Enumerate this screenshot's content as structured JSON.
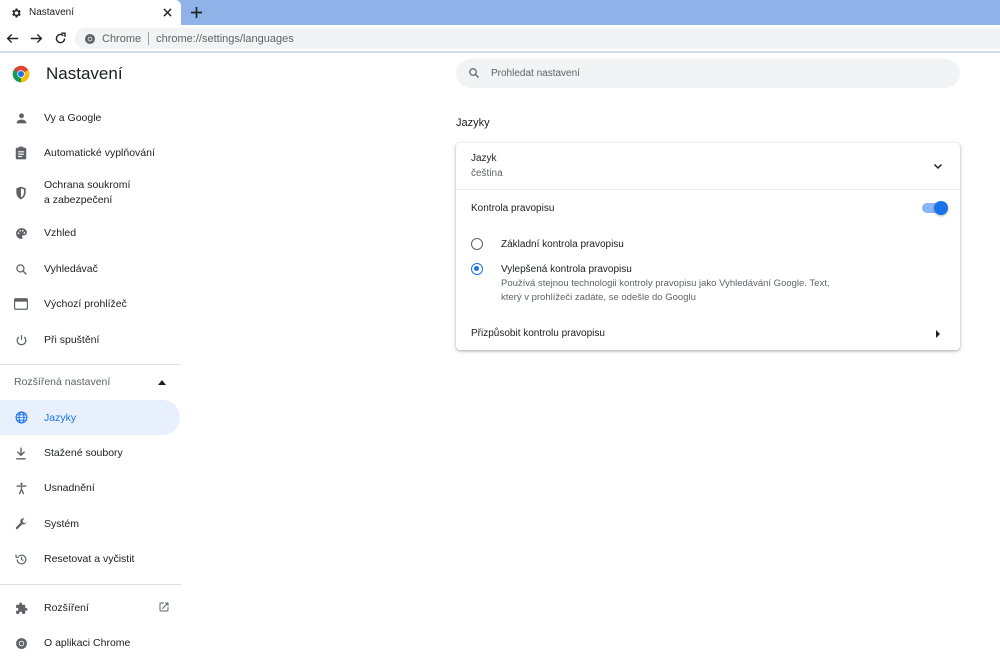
{
  "tab": {
    "title": "Nastavení",
    "icon": "gear-icon"
  },
  "omnibox": {
    "chip": "Chrome",
    "url": "chrome://settings/languages"
  },
  "app": {
    "title": "Nastavení"
  },
  "search": {
    "placeholder": "Prohledat nastavení"
  },
  "sidebar": {
    "items": [
      {
        "label": "Vy a Google",
        "icon": "person-icon"
      },
      {
        "label": "Automatické vyplňování",
        "icon": "clipboard-icon"
      },
      {
        "label_line1": "Ochrana soukromí",
        "label_line2": "a zabezpečení",
        "icon": "shield-icon"
      },
      {
        "label": "Vzhled",
        "icon": "palette-icon"
      },
      {
        "label": "Vyhledávač",
        "icon": "search-icon"
      },
      {
        "label": "Výchozí prohlížeč",
        "icon": "browser-icon"
      },
      {
        "label": "Při spuštění",
        "icon": "power-icon"
      }
    ],
    "advanced": {
      "label": "Rozšířená nastavení"
    },
    "advanced_items": [
      {
        "label": "Jazyky",
        "icon": "globe-icon"
      },
      {
        "label": "Stažené soubory",
        "icon": "download-icon"
      },
      {
        "label": "Usnadnění",
        "icon": "accessibility-icon"
      },
      {
        "label": "Systém",
        "icon": "wrench-icon"
      },
      {
        "label": "Resetovat a vyčistit",
        "icon": "restore-icon"
      }
    ],
    "extensions": {
      "label": "Rozšíření",
      "icon": "puzzle-icon"
    },
    "about": {
      "label": "O aplikaci Chrome",
      "icon": "chrome-icon"
    }
  },
  "main": {
    "section_title": "Jazyky",
    "language": {
      "label": "Jazyk",
      "value": "čeština"
    },
    "spellcheck": {
      "label": "Kontrola pravopisu",
      "enabled": true,
      "options": [
        {
          "label": "Základní kontrola pravopisu",
          "checked": false
        },
        {
          "label": "Vylepšená kontrola pravopisu",
          "checked": true,
          "desc_line1": "Používá stejnou technologii kontroly pravopisu jako Vyhledávání Google. Text,",
          "desc_line2": "který v prohlížeči zadáte, se odešle do Googlu"
        }
      ]
    },
    "customize": {
      "label": "Přizpůsobit kontrolu pravopisu"
    }
  },
  "colors": {
    "accent": "#1a73e8",
    "tabstrip": "#8fb3e8",
    "active_bg": "#e8f0fe"
  }
}
